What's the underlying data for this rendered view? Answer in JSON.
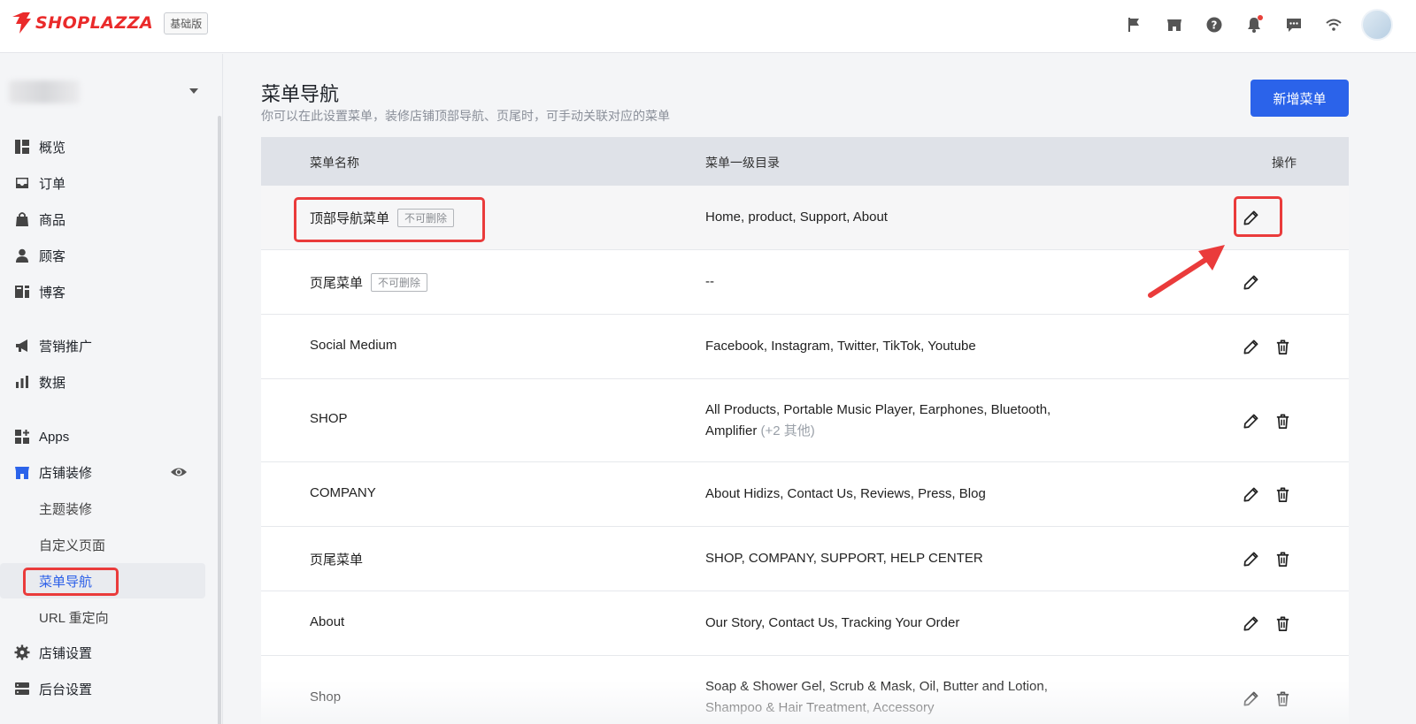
{
  "brand": {
    "name": "SHOPLAZZA",
    "plan": "基础版",
    "accent": "#2b63ea",
    "brand_red": "#ea2a2a",
    "highlight": "#ea3b3b"
  },
  "topbar": {
    "icons": [
      "flag-icon",
      "store-icon",
      "help-icon",
      "bell-icon",
      "message-icon",
      "wifi-icon",
      "avatar"
    ]
  },
  "sidebar": {
    "nav": [
      {
        "label": "概览",
        "icon": "dashboard-icon"
      },
      {
        "label": "订单",
        "icon": "inbox-icon"
      },
      {
        "label": "商品",
        "icon": "bag-icon"
      },
      {
        "label": "顾客",
        "icon": "person-icon"
      },
      {
        "label": "博客",
        "icon": "blog-icon"
      },
      {
        "label": "营销推广",
        "icon": "megaphone-icon"
      },
      {
        "label": "数据",
        "icon": "bar-chart-icon"
      },
      {
        "label": "Apps",
        "icon": "apps-icon"
      },
      {
        "label": "店铺装修",
        "icon": "storefront-icon"
      }
    ],
    "sub": [
      {
        "label": "主题装修"
      },
      {
        "label": "自定义页面"
      },
      {
        "label": "菜单导航",
        "active": true
      },
      {
        "label": "URL 重定向"
      }
    ],
    "bottom": [
      {
        "label": "店铺设置",
        "icon": "gear-icon"
      },
      {
        "label": "后台设置",
        "icon": "server-icon"
      }
    ]
  },
  "main": {
    "title": "菜单导航",
    "subtitle": "你可以在此设置菜单，装修店铺顶部导航、页尾时，可手动关联对应的菜单",
    "add_button": "新增菜单",
    "table": {
      "headers": {
        "name": "菜单名称",
        "items": "菜单一级目录",
        "actions": "操作"
      },
      "rows": [
        {
          "name": "顶部导航菜单",
          "tag": "不可删除",
          "items": "Home, product, Support, About",
          "deletable": false
        },
        {
          "name": "页尾菜单",
          "tag": "不可删除",
          "items": "--",
          "deletable": false
        },
        {
          "name": "Social Medium",
          "items": "Facebook, Instagram, Twitter, TikTok, Youtube",
          "deletable": true
        },
        {
          "name": "SHOP",
          "items": "All Products, Portable Music Player, Earphones, Bluetooth, Amplifier",
          "more": "(+2 其他)",
          "deletable": true
        },
        {
          "name": "COMPANY",
          "items": "About Hidizs, Contact Us, Reviews, Press, Blog",
          "deletable": true
        },
        {
          "name": "页尾菜单",
          "items": "SHOP, COMPANY, SUPPORT, HELP CENTER",
          "deletable": true
        },
        {
          "name": "About",
          "items": "Our Story, Contact Us, Tracking Your Order",
          "deletable": true
        },
        {
          "name": "Shop",
          "items": "Soap & Shower Gel, Scrub & Mask, Oil, Butter and Lotion, Shampoo & Hair Treatment, Accessory",
          "deletable": true
        }
      ]
    }
  }
}
